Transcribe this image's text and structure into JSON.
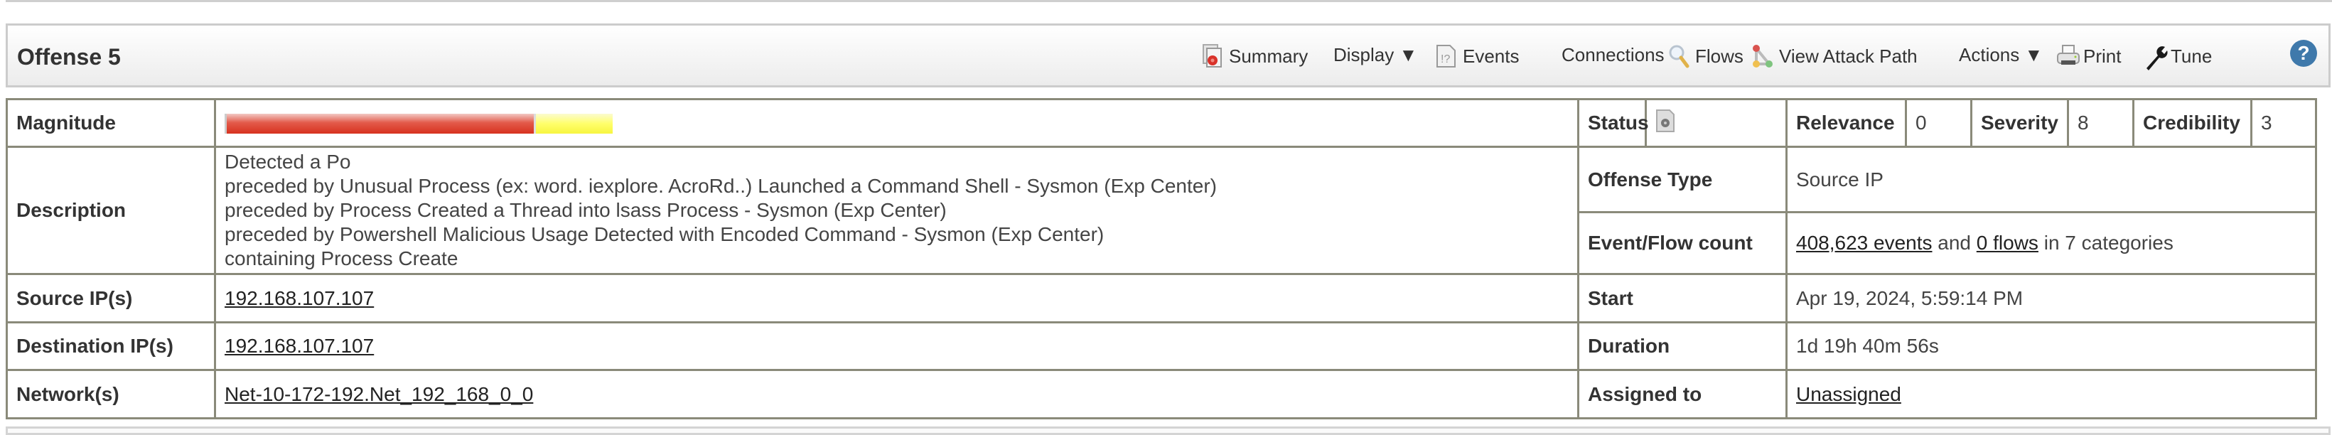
{
  "header": {
    "title": "Offense 5",
    "toolbar": [
      {
        "label": "Summary",
        "icon": "summary-icon"
      },
      {
        "label": "Display ▼",
        "icon": ""
      },
      {
        "label": "Events",
        "icon": "events-icon"
      },
      {
        "label": "Connections",
        "icon": ""
      },
      {
        "label": "Flows",
        "icon": "magnifier-icon"
      },
      {
        "label": "View Attack Path",
        "icon": "attack-path-icon"
      },
      {
        "label": "Actions ▼",
        "icon": ""
      },
      {
        "label": "Print",
        "icon": "printer-icon"
      },
      {
        "label": "Tune",
        "icon": "wrench-icon"
      }
    ],
    "help": "?"
  },
  "details": {
    "magnitude": {
      "label": "Magnitude",
      "red_fraction": 0.8,
      "yellow_fraction": 0.2
    },
    "status": {
      "label": "Status",
      "icon": "status-document-icon"
    },
    "relevance": {
      "label": "Relevance",
      "value": "0"
    },
    "severity": {
      "label": "Severity",
      "value": "8"
    },
    "credibility": {
      "label": "Credibility",
      "value": "3"
    },
    "description": {
      "label": "Description",
      "lines": [
        "Detected a Po",
        "preceded by Unusual Process (ex: word. iexplore. AcroRd..) Launched a Command Shell - Sysmon (Exp Center)",
        "preceded by Process Created a Thread into lsass Process - Sysmon (Exp Center)",
        "preceded by Powershell Malicious Usage Detected with Encoded Command - Sysmon (Exp Center)",
        "containing Process Create"
      ]
    },
    "offense_type": {
      "label": "Offense Type",
      "value": "Source IP"
    },
    "event_flow_count": {
      "label": "Event/Flow count",
      "events_link": "408,623 events",
      "and": " and ",
      "flows_link": "0 flows",
      "suffix": " in 7 categories"
    },
    "source_ips": {
      "label": "Source IP(s)",
      "value": "192.168.107.107"
    },
    "start": {
      "label": "Start",
      "value": "Apr 19, 2024, 5:59:14 PM"
    },
    "destination_ips": {
      "label": "Destination IP(s)",
      "value": "192.168.107.107"
    },
    "duration": {
      "label": "Duration",
      "value": "1d 19h 40m 56s"
    },
    "networks": {
      "label": "Network(s)",
      "value": "Net-10-172-192.Net_192_168_0_0"
    },
    "assigned_to": {
      "label": "Assigned to",
      "value": "Unassigned"
    }
  },
  "colors": {
    "bar_red": "#d7321f",
    "bar_yellow": "#ffff6a",
    "help_blue": "#3f79ab",
    "border": "#8a8a7a"
  }
}
